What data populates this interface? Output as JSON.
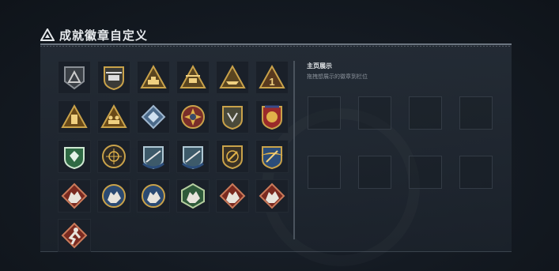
{
  "page": {
    "title": "成就徽章自定义"
  },
  "showcase": {
    "title": "主页展示",
    "hint": "拖拽想展示的徽章到栏位",
    "slots": 8
  },
  "colors": {
    "gold": "#c9a24a",
    "green": "#2f6a44",
    "blue": "#2b4d7a",
    "red": "#8a3a2e",
    "dark": "#1a2029"
  },
  "badges": [
    {
      "id": "gray-triangle-shield",
      "icon": "triangle-shield-icon"
    },
    {
      "id": "helicopter-shield",
      "icon": "helicopter-icon"
    },
    {
      "id": "tank-triangle",
      "icon": "tank-icon"
    },
    {
      "id": "chopper-triangle",
      "icon": "chopper-icon"
    },
    {
      "id": "boat-triangle",
      "icon": "boat-icon"
    },
    {
      "id": "number-one-triangle",
      "icon": "number-one-icon"
    },
    {
      "id": "tower-triangle",
      "icon": "tower-icon"
    },
    {
      "id": "soldiers-triangle",
      "icon": "soldiers-icon"
    },
    {
      "id": "diamond-blue",
      "icon": "gem-diamond-icon"
    },
    {
      "id": "cross-medal",
      "icon": "cross-medal-icon"
    },
    {
      "id": "eagle-shield",
      "icon": "eagle-shield-icon"
    },
    {
      "id": "star-ribbon",
      "icon": "star-ribbon-icon"
    },
    {
      "id": "green-shield",
      "icon": "green-shield-icon"
    },
    {
      "id": "crosshair-circle",
      "icon": "crosshair-icon"
    },
    {
      "id": "rifle-wreath-1",
      "icon": "rifle-wreath-icon"
    },
    {
      "id": "rifle-wreath-2",
      "icon": "rifle-wreath-icon"
    },
    {
      "id": "sword-circle",
      "icon": "sword-circle-icon"
    },
    {
      "id": "gold-wings",
      "icon": "gold-wings-icon"
    },
    {
      "id": "red-wolf",
      "icon": "wolf-icon"
    },
    {
      "id": "blue-wolf-1",
      "icon": "wolf-icon"
    },
    {
      "id": "blue-wolf-2",
      "icon": "wolf-icon"
    },
    {
      "id": "green-wolf",
      "icon": "wolf-icon"
    },
    {
      "id": "red-wolf-2",
      "icon": "wolf-icon"
    },
    {
      "id": "red-wolf-3",
      "icon": "wolf-icon"
    },
    {
      "id": "red-runner",
      "icon": "runner-icon"
    }
  ]
}
